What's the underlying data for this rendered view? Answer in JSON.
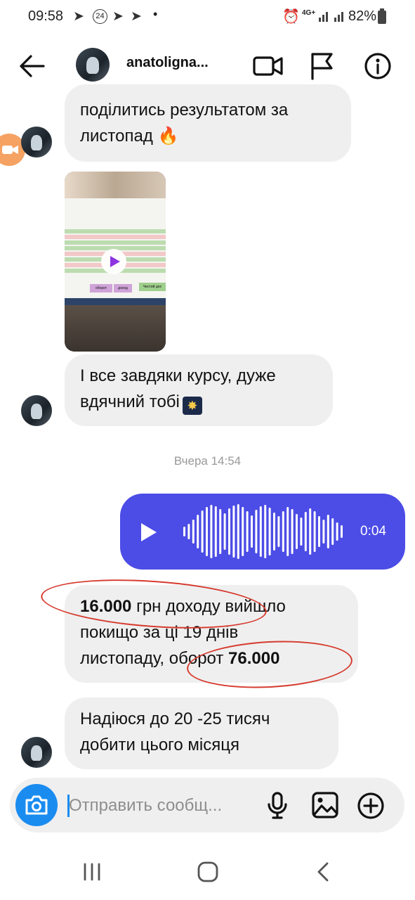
{
  "status_bar": {
    "time": "09:58",
    "tg_badge": "24",
    "battery": "82%",
    "network": "4G+"
  },
  "header": {
    "username": "anatolignа..."
  },
  "messages": {
    "m1_line1": "поділитись результатом за",
    "m1_line2": "листопад",
    "m2_line1": "І все завдяки курсу, дуже",
    "m2_line2": "вдячний тобі",
    "timestamp": "Вчера 14:54",
    "voice_duration": "0:04",
    "m3_num1": "16.000",
    "m3_line1_rest": " грн доходу вийшло",
    "m3_line2": "покищо за ці 19 днів",
    "m3_line3": "листопаду, оборот ",
    "m3_num2": "76.000",
    "m4_line1": "Надіюся до 20 -25 тисяч",
    "m4_line2": "добити цього місяця"
  },
  "spreadsheet": {
    "cell1": "оборот",
    "cell2": "доход",
    "cell3": "Чистий дох"
  },
  "composer": {
    "placeholder": "Отправить сообщ..."
  },
  "colors": {
    "voice_bubble": "#4c4ce6",
    "camera_button": "#1a8cf0",
    "annotation": "#d63a2e",
    "bubble": "#efefef"
  }
}
